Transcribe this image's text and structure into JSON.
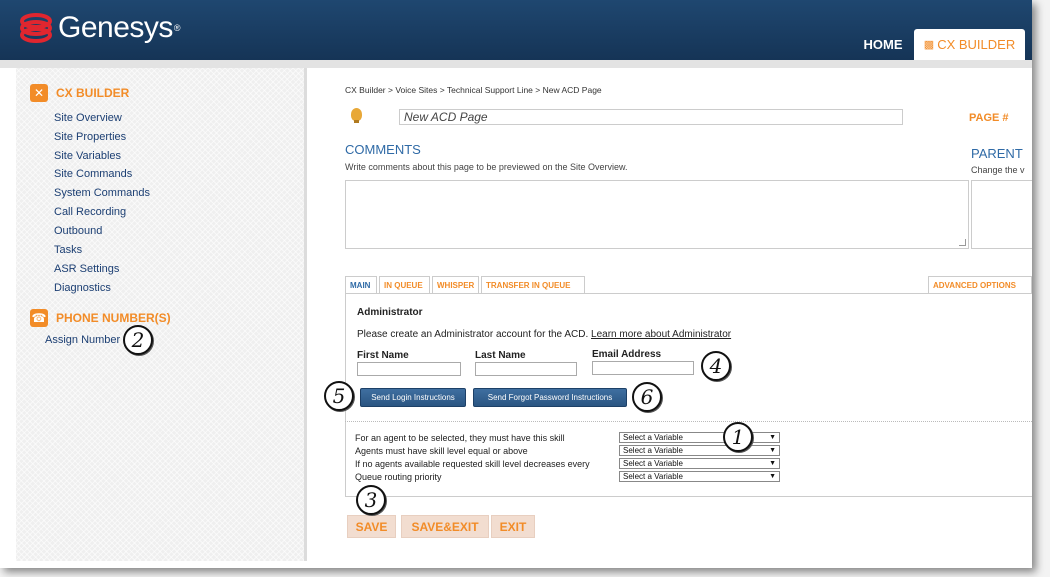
{
  "header": {
    "logo_text": "Genesys",
    "logo_tm": "®",
    "nav_home": "HOME",
    "nav_cx_builder": "CX BUILDER"
  },
  "sidebar": {
    "cx_builder_title": "CX BUILDER",
    "cx_items": [
      "Site Overview",
      "Site Properties",
      "Site Variables",
      "Site Commands",
      "System Commands",
      "Call Recording",
      "Outbound",
      "Tasks",
      "ASR Settings",
      "Diagnostics"
    ],
    "phone_title": "PHONE NUMBER(S)",
    "phone_items": [
      "Assign Number"
    ]
  },
  "main": {
    "breadcrumb": "CX Builder > Voice Sites > Technical Support Line > New ACD Page",
    "page_title_value": "New ACD Page",
    "page_num_label": "PAGE #",
    "comments_title": "COMMENTS",
    "comments_hint": "Write comments about this page to be previewed on the Site Overview.",
    "parent_title": "PARENT",
    "parent_hint": "Change the v",
    "tabs": [
      "MAIN",
      "IN QUEUE",
      "WHISPER",
      "TRANSFER IN QUEUE"
    ],
    "advanced_tab": "ADVANCED OPTIONS",
    "admin_title": "Administrator",
    "admin_text": "Please create an Administrator account for the ACD.",
    "admin_link": "Learn more about Administrator",
    "first_name_label": "First Name",
    "last_name_label": "Last Name",
    "email_label": "Email Address",
    "send_login_btn": "Send Login Instructions",
    "send_forgot_btn": "Send Forgot Password Instructions",
    "skills": [
      {
        "label": "For an agent to be selected, they must have this skill",
        "value": "Select a Variable"
      },
      {
        "label": "Agents must have skill level equal or above",
        "value": "Select a Variable"
      },
      {
        "label": "If no agents available requested skill level decreases every",
        "value": "Select a Variable"
      },
      {
        "label": "Queue routing priority",
        "value": "Select a Variable"
      }
    ],
    "save_btn": "SAVE",
    "save_exit_btn": "SAVE&EXIT",
    "exit_btn": "EXIT"
  },
  "callouts": [
    "1",
    "2",
    "3",
    "4",
    "5",
    "6"
  ],
  "colors": {
    "accent_orange": "#f28c28",
    "header_navy": "#1f4770",
    "link_blue": "#1c3f73",
    "heading_blue": "#2f6aa6"
  }
}
